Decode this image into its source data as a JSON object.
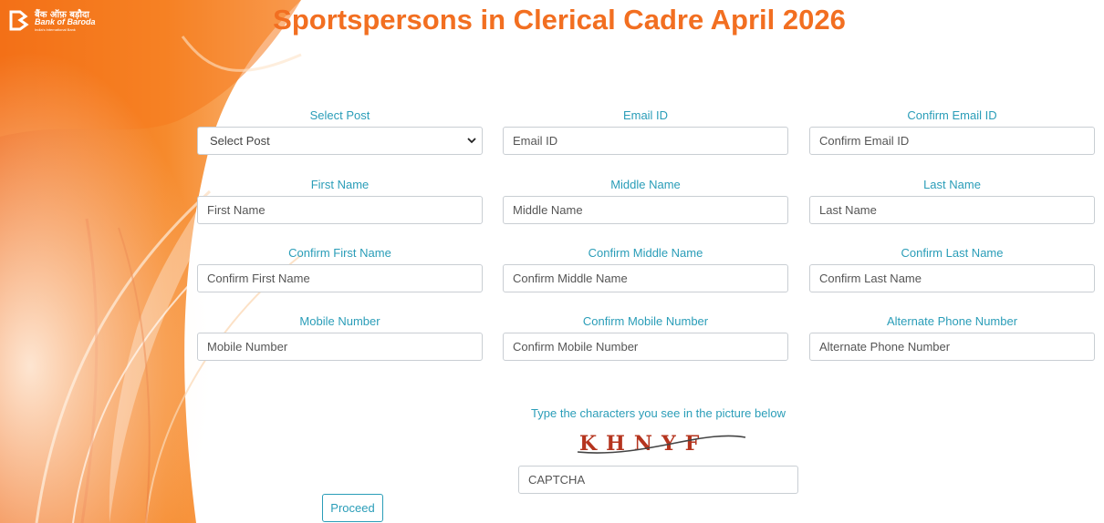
{
  "brand": {
    "hindi": "बैंक ऑफ़ बड़ौदा",
    "name": "Bank of Baroda",
    "tagline": "India's International Bank"
  },
  "page_title": "Sportspersons in Clerical Cadre April 2026",
  "fields": {
    "post": {
      "label": "Select Post",
      "value": "Select Post"
    },
    "email": {
      "label": "Email ID",
      "placeholder": "Email ID"
    },
    "confirm_email": {
      "label": "Confirm Email ID",
      "placeholder": "Confirm Email ID"
    },
    "first_name": {
      "label": "First Name",
      "placeholder": "First Name"
    },
    "middle_name": {
      "label": "Middle Name",
      "placeholder": "Middle Name"
    },
    "last_name": {
      "label": "Last Name",
      "placeholder": "Last Name"
    },
    "confirm_first_name": {
      "label": "Confirm First Name",
      "placeholder": "Confirm First Name"
    },
    "confirm_middle_name": {
      "label": "Confirm Middle Name",
      "placeholder": "Confirm Middle Name"
    },
    "confirm_last_name": {
      "label": "Confirm Last Name",
      "placeholder": "Confirm Last Name"
    },
    "mobile": {
      "label": "Mobile Number",
      "placeholder": "Mobile Number"
    },
    "confirm_mobile": {
      "label": "Confirm Mobile Number",
      "placeholder": "Confirm Mobile Number"
    },
    "alternate_phone": {
      "label": "Alternate Phone Number",
      "placeholder": "Alternate Phone Number"
    }
  },
  "captcha": {
    "instruction": "Type the characters you see in the picture below",
    "image_text": "KHNYF",
    "placeholder": "CAPTCHA"
  },
  "proceed_label": "Proceed",
  "colors": {
    "title": "#f26f21",
    "label": "#2a9db8",
    "background_orange": "#f47a1f"
  }
}
